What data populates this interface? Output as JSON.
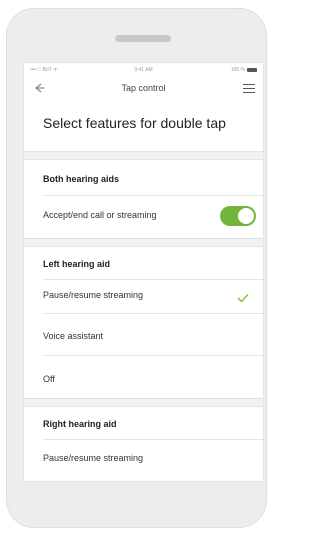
{
  "status_bar": {
    "carrier": "•••○○ BoT ᯤ",
    "time": "9:41 AM",
    "battery": "100 %"
  },
  "nav": {
    "title": "Tap control",
    "back_icon": "back-arrow-icon",
    "menu_icon": "menu-icon"
  },
  "page_title": "Select features for double tap",
  "sections": {
    "both": {
      "header": "Both hearing aids",
      "rows": [
        {
          "label": "Accept/end call or streaming",
          "toggle_on": true
        }
      ]
    },
    "left": {
      "header": "Left hearing aid",
      "rows": [
        {
          "label": "Pause/resume streaming",
          "selected": true
        },
        {
          "label": "Voice assistant",
          "selected": false
        },
        {
          "label": "Off",
          "selected": false
        }
      ]
    },
    "right": {
      "header": "Right hearing aid",
      "rows": [
        {
          "label": "Pause/resume streaming",
          "selected": false
        }
      ]
    }
  },
  "colors": {
    "accent": "#6fb53b",
    "check": "#8cc63f",
    "device_body": "#ededed"
  }
}
